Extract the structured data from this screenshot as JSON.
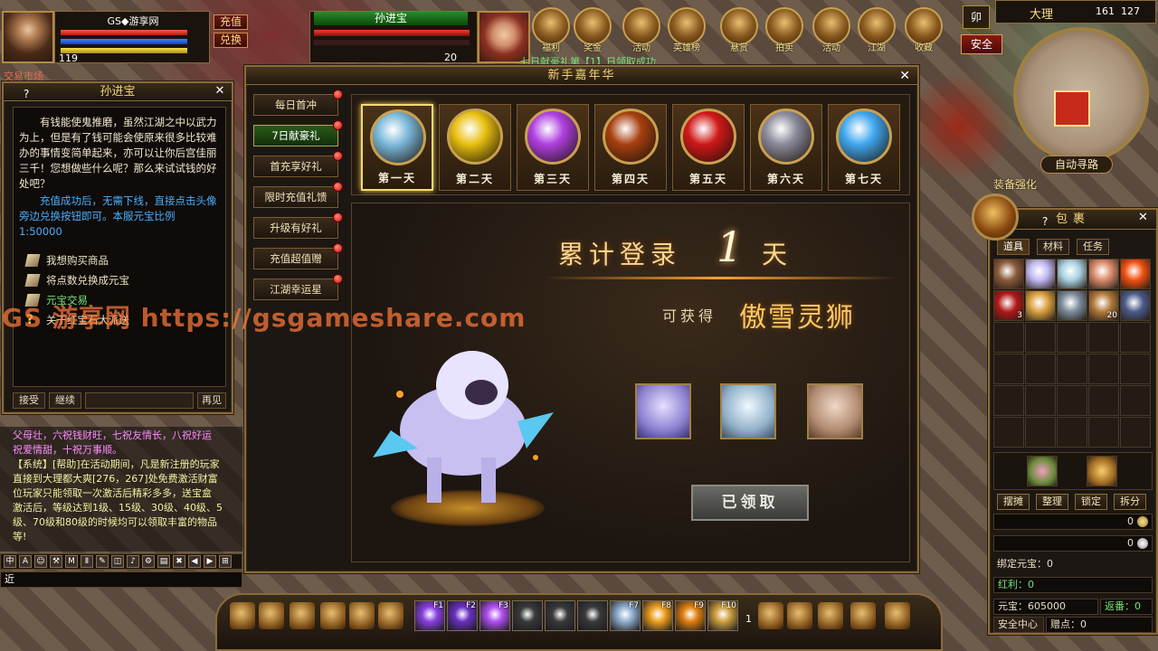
{
  "player": {
    "name": "GS◆游享网",
    "level": "119",
    "recharge_label": "充值",
    "exchange_label": "兑换"
  },
  "target": {
    "name": "孙进宝",
    "level": "20"
  },
  "market_label": "交易市场",
  "top_notice": "七日献豪礼第【1】日领取成功",
  "top_icons": [
    "福利",
    "奖金",
    "活动",
    "英雄榜",
    "悬赏",
    "拍卖",
    "活动",
    "江湖",
    "收藏"
  ],
  "minimap": {
    "location": "大理",
    "x": "161",
    "y": "127",
    "auto_path_label": "自动寻路",
    "safe_label": "安全",
    "mao_label": "卯",
    "equip_enhance_label": "装备强化"
  },
  "npc_dialog": {
    "title": "孙进宝",
    "text": "有钱能使鬼推磨，虽然江湖之中以武力为上，但是有了钱可能会使原来很多比较难办的事情变简单起来，亦可以让你后宫佳丽三千！您想做些什么呢？那么来试试钱的好处吧？",
    "note": "充值成功后，无需下线，直接点击头像旁边兑换按钮即可。本服元宝比例 1:50000",
    "options": [
      "我想购买商品",
      "将点数兑换成元宝",
      "元宝交易",
      "关于红宝石大派送"
    ],
    "accept_label": "接受",
    "continue_label": "继续",
    "goodbye_label": "再见"
  },
  "chat": {
    "lines": [
      "父母壮，六祝钱财旺，七祝友情长，八祝好运",
      "祝爱情甜，十祝万事顺。",
      "【系统】[帮助]在活动期间，凡是新注册的玩家",
      "直接到大理都大爽[276，267]处免费激活财富",
      "位玩家只能领取一次激活后精彩多多，送宝盒",
      "激活后，等级达到1级、15级、30级、40级、5",
      "级、70级和80级的时候均可以领取丰富的物品",
      "等!"
    ],
    "toolbar": [
      "中",
      "A",
      "☺",
      "⚒",
      "M",
      "Ⅱ",
      "✎",
      "◫",
      "♪",
      "⚙",
      "▤",
      "✖",
      "◀",
      "▶",
      "⊞"
    ],
    "input_value": "近"
  },
  "carnival": {
    "title": "新手嘉年华",
    "tabs": [
      "每日首冲",
      "7日献豪礼",
      "首充享好礼",
      "限时充值礼馈",
      "升级有好礼",
      "充值超值赠",
      "江湖幸运星"
    ],
    "active_tab": 1,
    "days": [
      {
        "label": "第一天",
        "color": "#7ab8d8"
      },
      {
        "label": "第二天",
        "color": "#e8c010"
      },
      {
        "label": "第三天",
        "color": "#b040e0"
      },
      {
        "label": "第四天",
        "color": "#a84010"
      },
      {
        "label": "第五天",
        "color": "#d01818"
      },
      {
        "label": "第六天",
        "color": "#8a8a9a"
      },
      {
        "label": "第七天",
        "color": "#40a8f0"
      }
    ],
    "active_day": 0,
    "login_prefix": "累计登录",
    "login_day": "1",
    "login_suffix": "天",
    "can_get_label": "可获得",
    "reward_name": "傲雪灵狮",
    "claim_label": "已领取"
  },
  "bag": {
    "title": "包裹",
    "tabs": [
      "道具",
      "材料",
      "任务"
    ],
    "items": [
      {
        "slot": 0,
        "color": "#8a5a3a",
        "count": ""
      },
      {
        "slot": 1,
        "color": "#c0b8f0",
        "count": ""
      },
      {
        "slot": 2,
        "color": "#a8d0e0",
        "count": ""
      },
      {
        "slot": 3,
        "color": "#d88a6a",
        "count": ""
      },
      {
        "slot": 4,
        "color": "#f05010",
        "count": ""
      },
      {
        "slot": 5,
        "color": "#b01818",
        "count": "3"
      },
      {
        "slot": 6,
        "color": "#d8a040",
        "count": ""
      },
      {
        "slot": 7,
        "color": "#7a8a9a",
        "count": ""
      },
      {
        "slot": 8,
        "color": "#b0783a",
        "count": "20"
      },
      {
        "slot": 9,
        "color": "#4a5a8a",
        "count": ""
      }
    ],
    "actions": [
      "摆摊",
      "整理",
      "锁定",
      "拆分"
    ],
    "gold_value": "0",
    "silver_value": "0",
    "bound_yuanbao": "绑定元宝：0",
    "red_profit": "红利：0",
    "yuanbao": "元宝：605000",
    "return_label": "返番：0",
    "safe_center_label": "安全中心",
    "gift_points": "赠点：0"
  },
  "skillbar": {
    "keys": [
      "F1",
      "F2",
      "F3",
      "",
      "",
      "",
      "F7",
      "F8",
      "F9",
      "F10"
    ],
    "page": "1"
  },
  "watermark": "GS 游享网 https://gsgameshare.com"
}
